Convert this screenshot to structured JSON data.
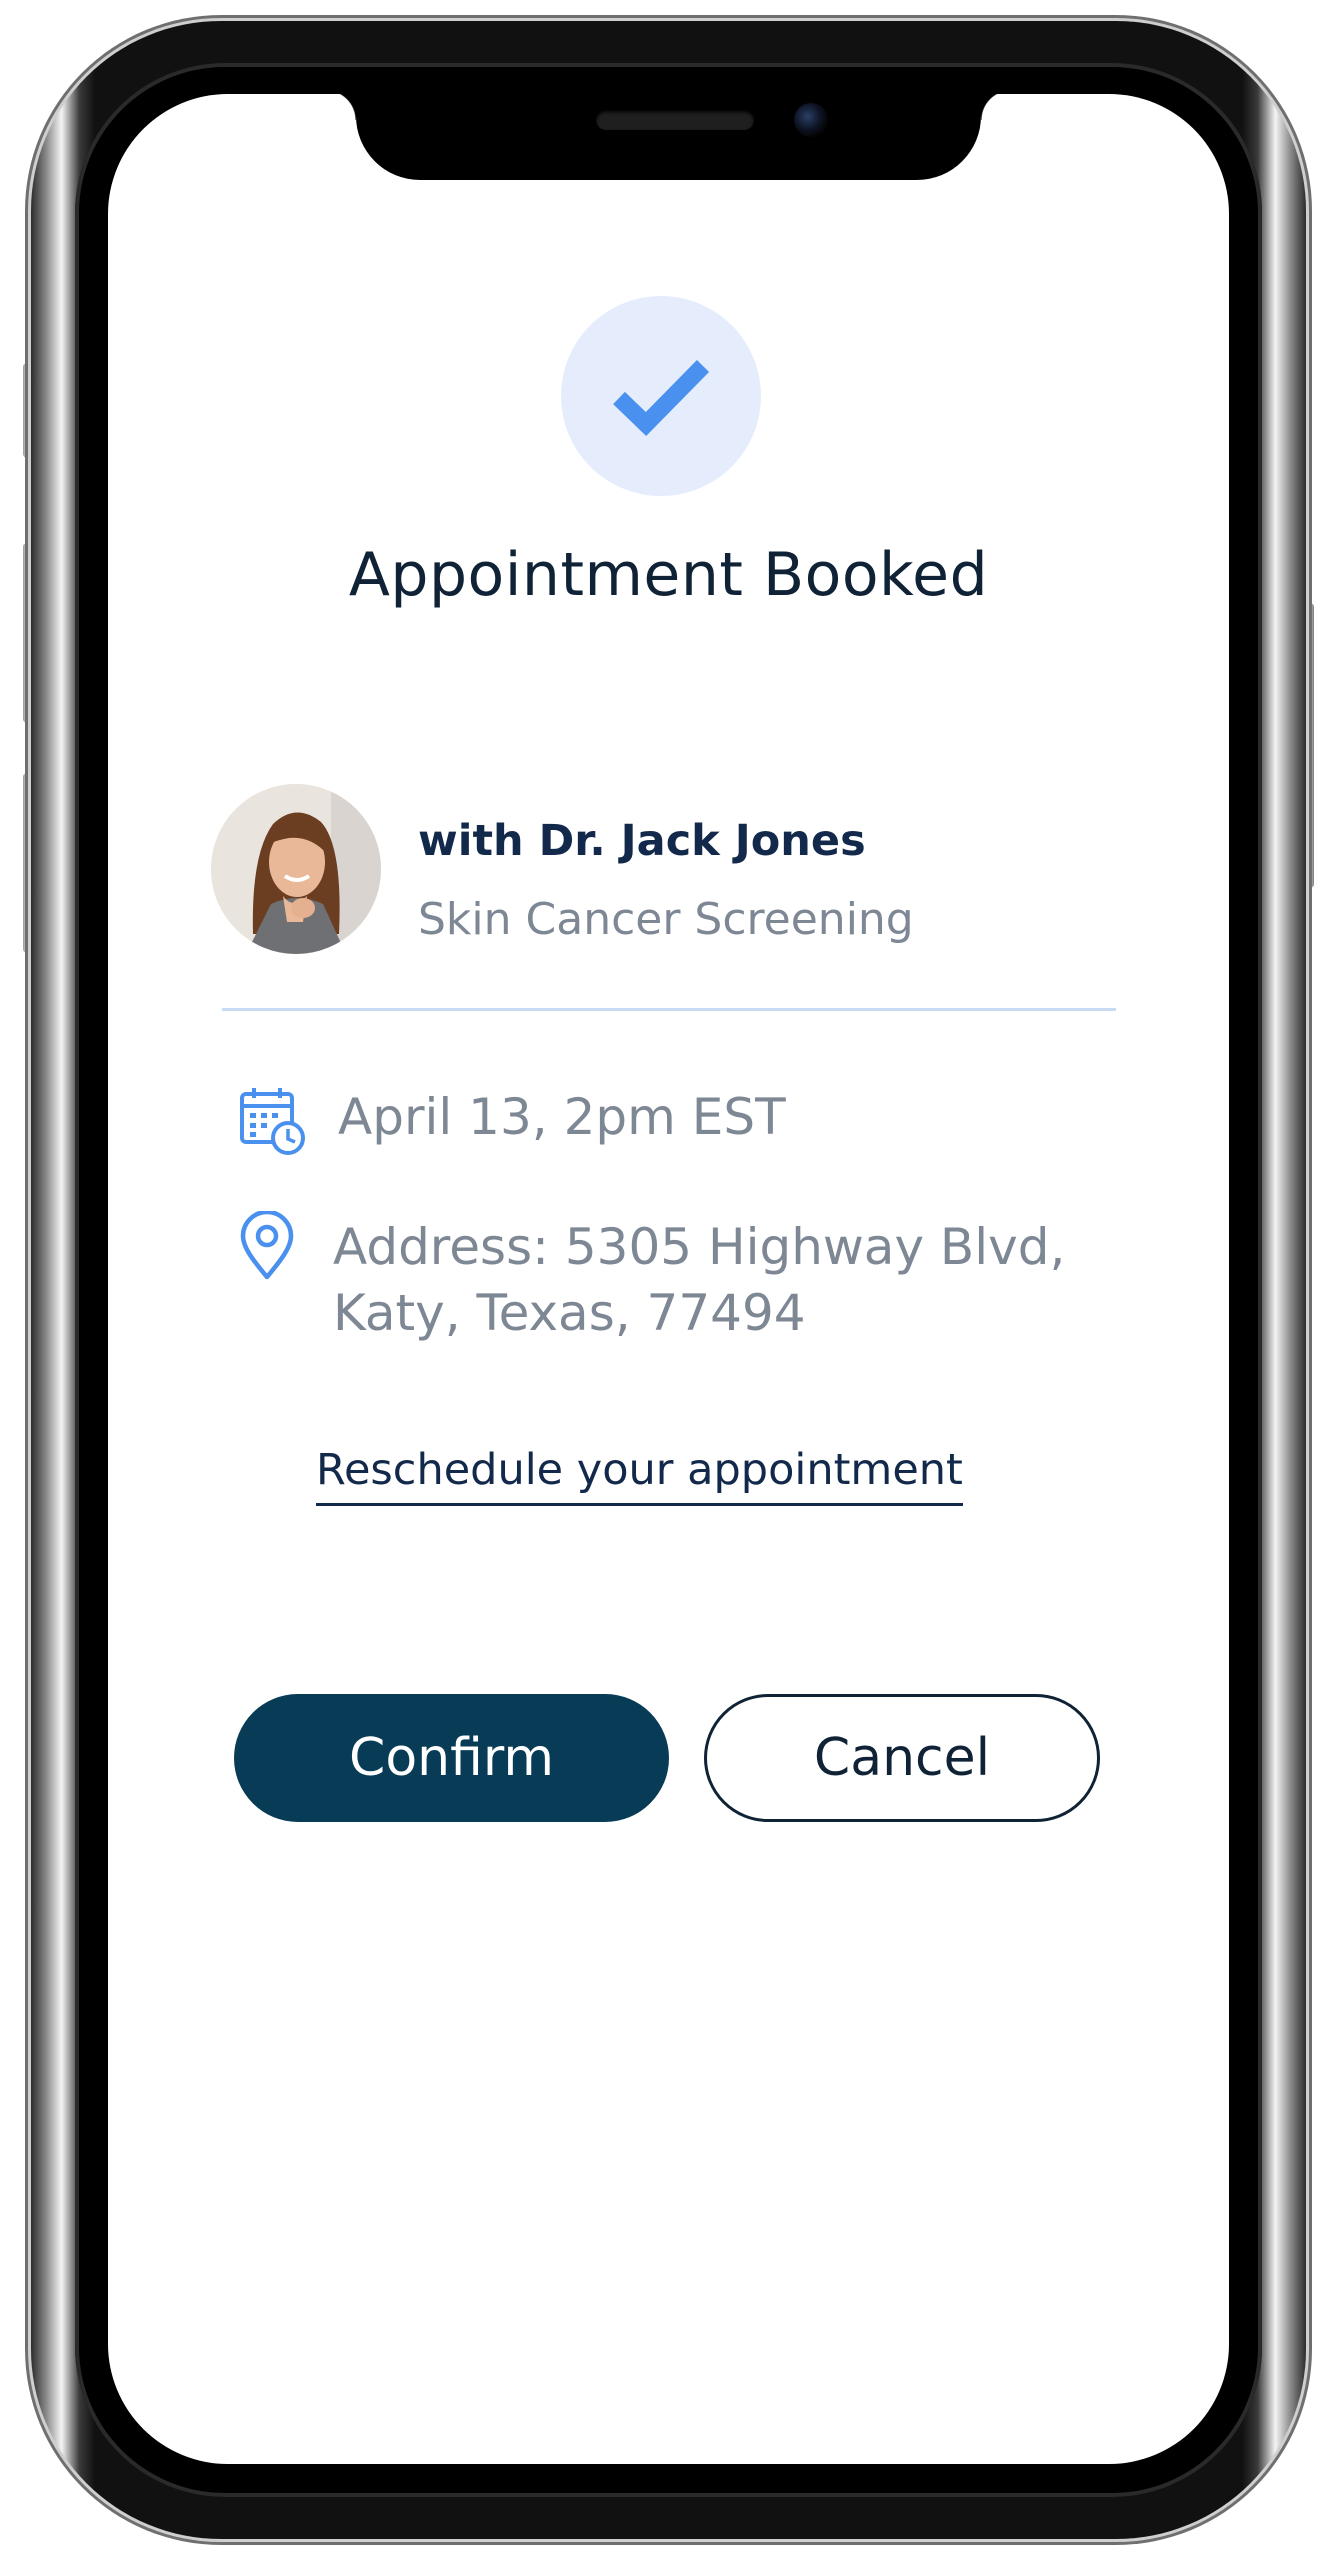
{
  "confirmation": {
    "title": "Appointment Booked",
    "status_icon": "check-icon"
  },
  "doctor": {
    "name_line": "with Dr. Jack Jones",
    "service": "Skin Cancer Screening",
    "avatar_icon": "doctor-avatar"
  },
  "details": {
    "datetime": "April 13, 2pm EST",
    "address_line1": "Address: 5305 Highway Blvd,",
    "address_line2": "Katy, Texas, 77494",
    "date_icon": "calendar-clock-icon",
    "address_icon": "location-pin-icon"
  },
  "actions": {
    "reschedule_label": "Reschedule your appointment",
    "confirm_label": "Confirm",
    "cancel_label": "Cancel"
  },
  "colors": {
    "primary": "#083b56",
    "title_text": "#0f2236",
    "secondary_text": "#7e8794",
    "accent_blue": "#4a90ee",
    "badge_bg": "#e5edfd",
    "divider": "#c7dcf2"
  }
}
